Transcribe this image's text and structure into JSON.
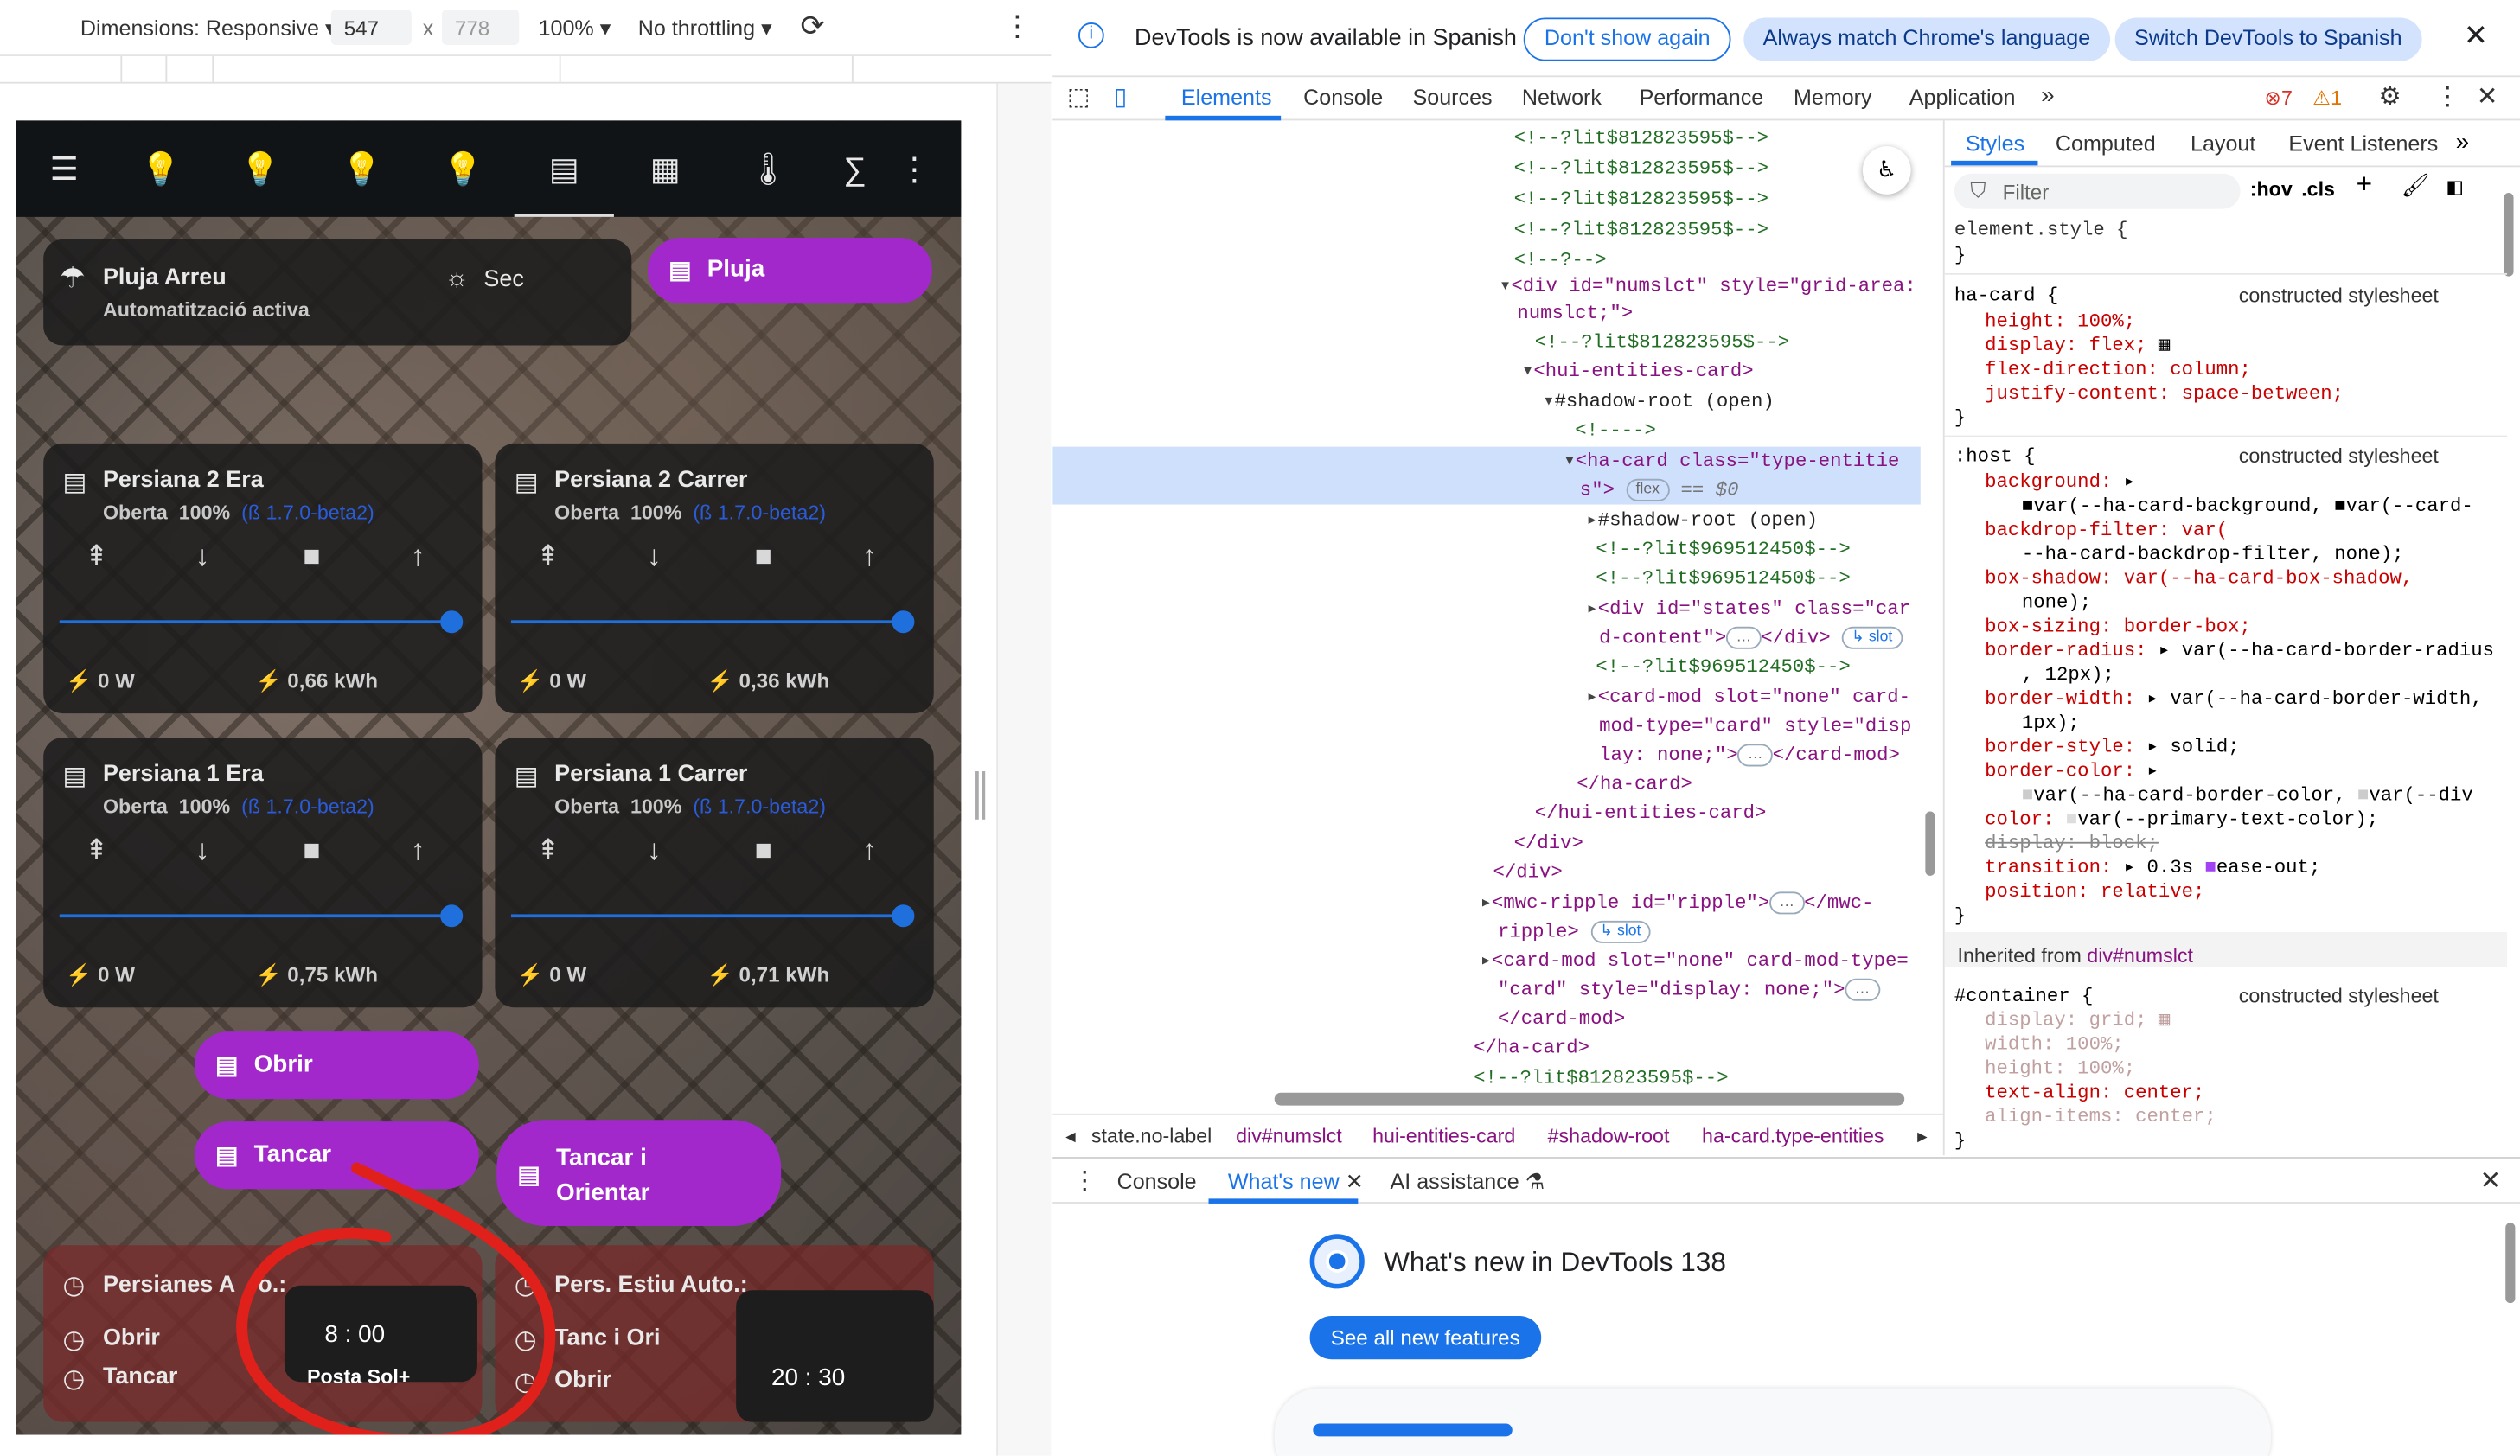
{
  "device_toolbar": {
    "dimensions_label": "Dimensions: Responsive",
    "width_value": "547",
    "x_separator": "x",
    "height_value": "778",
    "zoom": "100%",
    "throttling": "No throttling"
  },
  "ha": {
    "header_icons": [
      "menu-icon",
      "bulb-e-icon",
      "bulb-0-icon",
      "bulb-1-icon",
      "bulb-2-icon",
      "blinds-icon",
      "garage-icon",
      "thermometer-icon",
      "sigma-icon",
      "more-icon"
    ],
    "rain_card": {
      "title": "Pluja Arreu",
      "subtitle": "Automatització activa",
      "state": "Sec"
    },
    "rain_pill": "Pluja",
    "blinds": [
      {
        "title": "Persiana 2 Era",
        "state": "Oberta",
        "percent": "100%",
        "beta": "(ß 1.7.0-beta2)",
        "power": "0 W",
        "energy": "0,66 kWh",
        "position": 1.0
      },
      {
        "title": "Persiana 2 Carrer",
        "state": "Oberta",
        "percent": "100%",
        "beta": "(ß 1.7.0-beta2)",
        "power": "0 W",
        "energy": "0,36 kWh",
        "position": 1.0
      },
      {
        "title": "Persiana 1 Era",
        "state": "Oberta",
        "percent": "100%",
        "beta": "(ß 1.7.0-beta2)",
        "power": "0 W",
        "energy": "0,75 kWh",
        "position": 1.0
      },
      {
        "title": "Persiana 1 Carrer",
        "state": "Oberta",
        "percent": "100%",
        "beta": "(ß 1.7.0-beta2)",
        "power": "0 W",
        "energy": "0,71 kWh",
        "position": 1.0
      }
    ],
    "buttons": {
      "open": "Obrir",
      "close": "Tancar",
      "close_orient_1": "Tancar i",
      "close_orient_2": "Orientar"
    },
    "auto_left": {
      "title": "Persianes A",
      "title_tail": "o.:",
      "row1": "Obrir",
      "row2": "Tancar",
      "time": "8 : 00",
      "time_sub": "Posta Sol+"
    },
    "auto_right": {
      "title": "Pers. Estiu Auto.:",
      "row1": "Tanc i Ori",
      "row2": "Obrir",
      "time": "20 : 30"
    }
  },
  "devtools": {
    "banner": {
      "message": "DevTools is now available in Spanish",
      "dont_show": "Don't show again",
      "always_match": "Always match Chrome's language",
      "switch": "Switch DevTools to Spanish"
    },
    "tabs": [
      "Elements",
      "Console",
      "Sources",
      "Network",
      "Performance",
      "Memory",
      "Application"
    ],
    "errors": "7",
    "warnings": "1",
    "elements_lines": [
      {
        "indent": 0,
        "kind": "cm",
        "text": "<!--?lit$812823595$-->"
      },
      {
        "indent": 0,
        "kind": "cm",
        "text": "<!--?lit$812823595$-->"
      },
      {
        "indent": 0,
        "kind": "cm",
        "text": "<!--?lit$812823595$-->"
      },
      {
        "indent": 0,
        "kind": "cm",
        "text": "<!--?lit$812823595$-->"
      },
      {
        "indent": 0,
        "kind": "cm",
        "text": "<!--?-->"
      }
    ],
    "dom": {
      "numslct_open": "<div id=\"numslct\" style=\"grid-area:",
      "numslct_cont": "numslct;\">",
      "lit1": "<!--?lit$812823595$-->",
      "hui_open": "<hui-entities-card>",
      "shadow_root": "#shadow-root (open)",
      "empty_comment": "<!---->",
      "hacard_open": "<ha-card class=\"type-entitie",
      "hacard_cont": "s\">",
      "flex_badge": "flex",
      "selected_marker": "== $0",
      "inner_shadow": "#shadow-root (open)",
      "lit2a": "<!--?lit$969512450$-->",
      "lit2b": "<!--?lit$969512450$-->",
      "states_div": "<div id=\"states\" class=\"car",
      "states_cont": "d-content\">",
      "states_close": "</div>",
      "slot_badge": "slot",
      "lit2c": "<!--?lit$969512450$-->",
      "cardmod1": "<card-mod slot=\"none\" card-",
      "cardmod2": "mod-type=\"card\" style=\"disp",
      "cardmod3": "lay: none;\">",
      "cardmod_close": "</card-mod>",
      "hacard_close": "</ha-card>",
      "hui_close": "</hui-entities-card>",
      "div_close1": "</div>",
      "div_close2": "</div>",
      "ripple1": "<mwc-ripple id=\"ripple\">",
      "ripple_close": "</mwc-",
      "ripple2": "ripple>",
      "cardmod_b1": "<card-mod slot=\"none\" card-mod-type=",
      "cardmod_b2": "\"card\" style=\"display: none;\">",
      "cardmod_b3": "</card-mod>",
      "hacard_close2": "</ha-card>",
      "lit3": "<!--?lit$812823595$-->"
    },
    "breadcrumbs": [
      "state.no-label",
      "div#numslct",
      "hui-entities-card",
      "#shadow-root",
      "ha-card.type-entities"
    ],
    "styles_tabs": [
      "Styles",
      "Computed",
      "Layout",
      "Event Listeners"
    ],
    "filter_placeholder": "Filter",
    "hov": ":hov",
    "cls": ".cls",
    "styles": {
      "element_style": "element.style {",
      "close": "}",
      "hacard_sel": "ha-card {",
      "constructed": "constructed stylesheet",
      "height": "height: 100%;",
      "display_flex": "display: flex;",
      "flex_dir": "flex-direction: column;",
      "justify": "justify-content: space-between;",
      "host_sel": ":host {",
      "background": "background:",
      "bg_val": "var(--ha-card-background, ",
      "bg_val2": "var(--card-",
      "backdrop": "backdrop-filter: var(",
      "backdrop2": "--ha-card-backdrop-filter, none);",
      "box_shadow": "box-shadow: var(--ha-card-box-shadow,",
      "box_shadow2": "none);",
      "box_sizing": "box-sizing: border-box;",
      "border_radius": "border-radius:",
      "border_radius_val": "var(--ha-card-border-radius",
      "border_radius2": ", 12px);",
      "border_width": "border-width:",
      "border_width_val": "var(--ha-card-border-width,",
      "border_width2": "1px);",
      "border_style": "border-style:",
      "border_style_val": "solid;",
      "border_color": "border-color:",
      "border_color_val": "var(--ha-card-border-color, ",
      "border_color_val2": "var(--div",
      "color": "color:",
      "color_val": "var(--primary-text-color);",
      "display_block": "display: block;",
      "transition": "transition:",
      "transition_val": "0.3s",
      "transition_val2": "ease-out;",
      "position": "position: relative;",
      "inherited": "Inherited from ",
      "inherited_from": "div#numslct",
      "container_sel": "#container {",
      "c_display": "display: grid;",
      "c_width": "width: 100%;",
      "c_height": "height: 100%;",
      "c_text_align": "text-align: center;",
      "c_align": "align-items: center;"
    },
    "drawer": {
      "tabs": [
        "Console",
        "What's new",
        "AI assistance"
      ],
      "heading": "What's new in DevTools 138",
      "button": "See all new features"
    }
  },
  "colors": {
    "accent": "#1a73e8",
    "pill": "#a328cc",
    "slider": "#1f6fdc"
  }
}
